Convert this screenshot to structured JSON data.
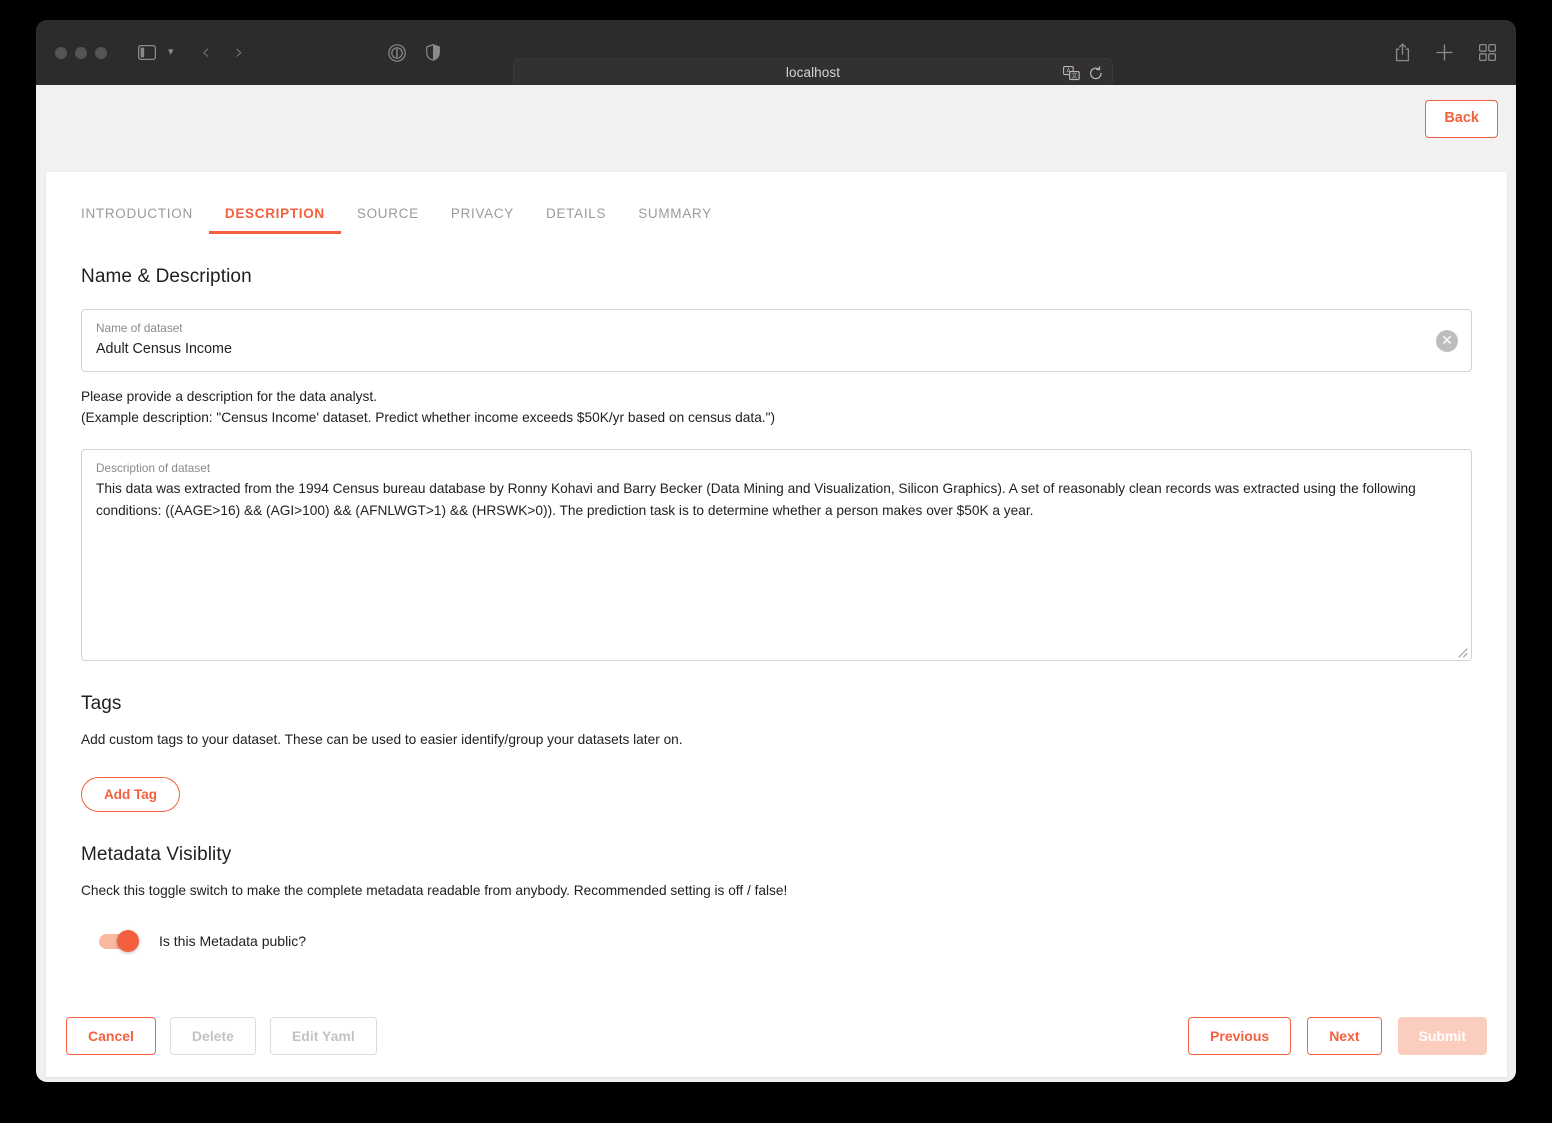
{
  "browser": {
    "url": "localhost",
    "icons": {
      "sidebar": "sidebar-icon",
      "sidebar_chevron": "chevron-down-icon",
      "back": "back-arrow-icon",
      "forward": "forward-arrow-icon",
      "reader": "reader-mode-icon",
      "privacy": "privacy-shield-icon",
      "translate": "translate-icon",
      "reload": "reload-icon",
      "share": "share-icon",
      "new_tab": "plus-icon",
      "tab_overview": "tab-overview-icon"
    }
  },
  "header": {
    "back_label": "Back"
  },
  "tabs": [
    {
      "label": "INTRODUCTION",
      "active": false
    },
    {
      "label": "DESCRIPTION",
      "active": true
    },
    {
      "label": "SOURCE",
      "active": false
    },
    {
      "label": "PRIVACY",
      "active": false
    },
    {
      "label": "DETAILS",
      "active": false
    },
    {
      "label": "SUMMARY",
      "active": false
    }
  ],
  "name_description": {
    "title": "Name & Description",
    "name_field": {
      "label": "Name of dataset",
      "value": "Adult Census Income",
      "clear_icon": "clear-circle-icon"
    },
    "helper_line1": "Please provide a description for the data analyst.",
    "helper_line2": "(Example description: \"Census Income' dataset. Predict whether income exceeds $50K/yr based on census data.\")",
    "description_field": {
      "label": "Description of dataset",
      "value": "This data was extracted from the 1994 Census bureau database by Ronny Kohavi and Barry Becker (Data Mining and Visualization, Silicon Graphics). A set of reasonably clean records was extracted using the following conditions: ((AAGE>16) && (AGI>100) && (AFNLWGT>1) && (HRSWK>0)). The prediction task is to determine whether a person makes over $50K a year.",
      "resize_grip": "resize-grip-icon"
    }
  },
  "tags": {
    "title": "Tags",
    "helper": "Add custom tags to your dataset. These can be used to easier identify/group your datasets later on.",
    "add_tag_label": "Add Tag"
  },
  "metadata_visibility": {
    "title": "Metadata Visiblity",
    "helper": "Check this toggle switch to make the complete metadata readable from anybody. Recommended setting is off / false!",
    "toggle_label": "Is this Metadata public?",
    "toggle_on": true
  },
  "footer": {
    "cancel_label": "Cancel",
    "delete_label": "Delete",
    "edit_yaml_label": "Edit Yaml",
    "previous_label": "Previous",
    "next_label": "Next",
    "submit_label": "Submit"
  },
  "colors": {
    "accent": "#f4603e",
    "accent_disabled": "#fbcdbe",
    "text": "#212121",
    "muted": "#9b9b9b",
    "page_bg": "#f1f1f1",
    "chrome_bg": "#2d2b2c"
  }
}
